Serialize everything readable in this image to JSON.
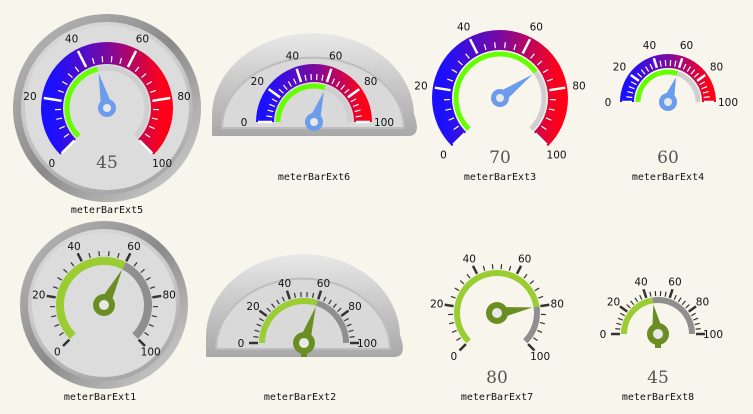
{
  "colors": {
    "background": "#f8f5ec",
    "gradient_low": "#1a10ff",
    "gradient_mid": "#7a0aa0",
    "gradient_high": "#ff0018",
    "value_arc_bright": "#66ff00",
    "value_arc_olive": "#9acd32",
    "needle_blue": "#6c9cec",
    "needle_olive": "#6b8e23",
    "remainder_arc": "#8f8f8f"
  },
  "gauges": [
    {
      "id": "meterBarExt5",
      "caption": "meterBarExt5",
      "value": 45,
      "value_text": "45",
      "min": 0,
      "max": 100,
      "ticks": [
        "0",
        "20",
        "40",
        "60",
        "80",
        "100"
      ],
      "style": "gradient",
      "face": "round"
    },
    {
      "id": "meterBarExt6",
      "caption": "meterBarExt6",
      "value": 60,
      "value_text": "",
      "min": 0,
      "max": 100,
      "ticks": [
        "0",
        "20",
        "40",
        "60",
        "80",
        "100"
      ],
      "style": "gradient",
      "face": "half"
    },
    {
      "id": "meterBarExt3",
      "caption": "meterBarExt3",
      "value": 70,
      "value_text": "70",
      "min": 0,
      "max": 100,
      "ticks": [
        "0",
        "20",
        "40",
        "60",
        "80",
        "100"
      ],
      "style": "gradient",
      "face": "none"
    },
    {
      "id": "meterBarExt4",
      "caption": "meterBarExt4",
      "value": 60,
      "value_text": "60",
      "min": 0,
      "max": 100,
      "ticks": [
        "0",
        "20",
        "40",
        "60",
        "80",
        "100"
      ],
      "style": "gradient",
      "face": "none-half"
    },
    {
      "id": "meterBarExt1",
      "caption": "meterBarExt1",
      "value": 60,
      "value_text": "",
      "min": 0,
      "max": 100,
      "ticks": [
        "0",
        "20",
        "40",
        "60",
        "80",
        "100"
      ],
      "style": "olive",
      "face": "round"
    },
    {
      "id": "meterBarExt2",
      "caption": "meterBarExt2",
      "value": 60,
      "value_text": "",
      "min": 0,
      "max": 100,
      "ticks": [
        "0",
        "20",
        "40",
        "60",
        "80",
        "100"
      ],
      "style": "olive",
      "face": "half"
    },
    {
      "id": "meterBarExt7",
      "caption": "meterBarExt7",
      "value": 80,
      "value_text": "80",
      "min": 0,
      "max": 100,
      "ticks": [
        "0",
        "20",
        "40",
        "60",
        "80",
        "100"
      ],
      "style": "olive",
      "face": "none"
    },
    {
      "id": "meterBarExt8",
      "caption": "meterBarExt8",
      "value": 45,
      "value_text": "45",
      "min": 0,
      "max": 100,
      "ticks": [
        "0",
        "20",
        "40",
        "60",
        "80",
        "100"
      ],
      "style": "olive",
      "face": "none-half"
    }
  ]
}
